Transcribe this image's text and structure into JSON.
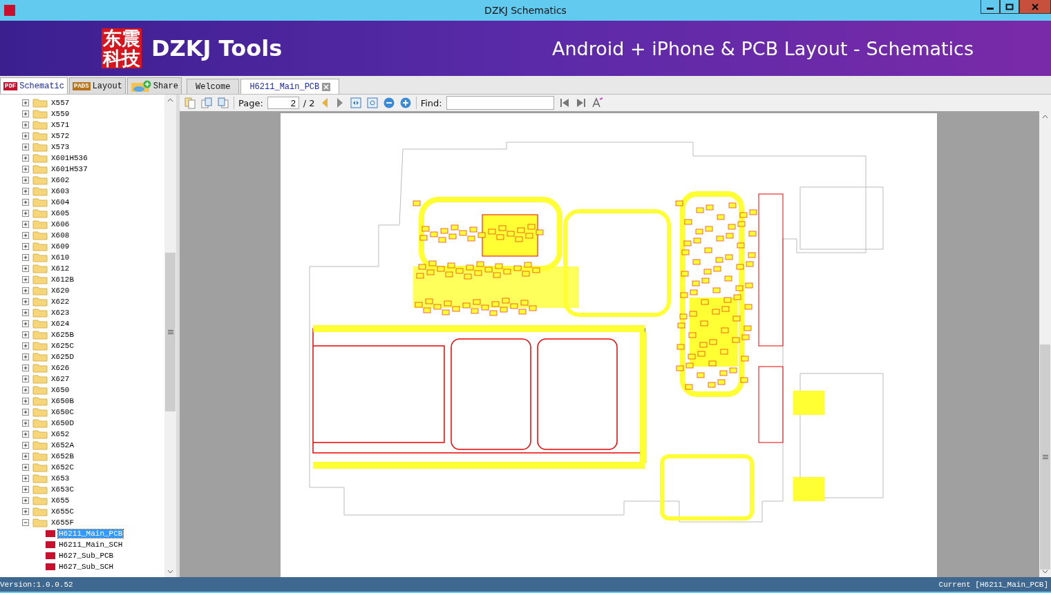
{
  "window": {
    "title": "DZKJ Schematics"
  },
  "banner": {
    "logo_text": "东震科技",
    "brand": "DZKJ Tools",
    "tagline": "Android + iPhone & PCB Layout - Schematics"
  },
  "side_tabs": [
    {
      "label": "Schematic",
      "badge": "PDF",
      "kind": "pdf",
      "selected": true
    },
    {
      "label": "Layout",
      "badge": "PADS",
      "kind": "pads",
      "selected": false
    },
    {
      "label": "Share",
      "kind": "share",
      "selected": false
    }
  ],
  "doc_tabs": [
    {
      "label": "Welcome",
      "selected": false,
      "closable": false
    },
    {
      "label": "H6211_Main_PCB",
      "selected": true,
      "closable": true
    }
  ],
  "tree": [
    {
      "label": "X557",
      "expanded": false
    },
    {
      "label": "X559",
      "expanded": false
    },
    {
      "label": "X571",
      "expanded": false
    },
    {
      "label": "X572",
      "expanded": false
    },
    {
      "label": "X573",
      "expanded": false
    },
    {
      "label": "X601H536",
      "expanded": false
    },
    {
      "label": "X601H537",
      "expanded": false
    },
    {
      "label": "X602",
      "expanded": false
    },
    {
      "label": "X603",
      "expanded": false
    },
    {
      "label": "X604",
      "expanded": false
    },
    {
      "label": "X605",
      "expanded": false
    },
    {
      "label": "X606",
      "expanded": false
    },
    {
      "label": "X608",
      "expanded": false
    },
    {
      "label": "X609",
      "expanded": false
    },
    {
      "label": "X610",
      "expanded": false
    },
    {
      "label": "X612",
      "expanded": false
    },
    {
      "label": "X612B",
      "expanded": false
    },
    {
      "label": "X620",
      "expanded": false
    },
    {
      "label": "X622",
      "expanded": false
    },
    {
      "label": "X623",
      "expanded": false
    },
    {
      "label": "X624",
      "expanded": false
    },
    {
      "label": "X625B",
      "expanded": false
    },
    {
      "label": "X625C",
      "expanded": false
    },
    {
      "label": "X625D",
      "expanded": false
    },
    {
      "label": "X626",
      "expanded": false
    },
    {
      "label": "X627",
      "expanded": false
    },
    {
      "label": "X650",
      "expanded": false
    },
    {
      "label": "X650B",
      "expanded": false
    },
    {
      "label": "X650C",
      "expanded": false
    },
    {
      "label": "X650D",
      "expanded": false
    },
    {
      "label": "X652",
      "expanded": false
    },
    {
      "label": "X652A",
      "expanded": false
    },
    {
      "label": "X652B",
      "expanded": false
    },
    {
      "label": "X652C",
      "expanded": false
    },
    {
      "label": "X653",
      "expanded": false
    },
    {
      "label": "X653C",
      "expanded": false
    },
    {
      "label": "X655",
      "expanded": false
    },
    {
      "label": "X655C",
      "expanded": false
    },
    {
      "label": "X655F",
      "expanded": true,
      "children": [
        {
          "label": "H6211_Main_PCB",
          "selected": true
        },
        {
          "label": "H6211_Main_SCH",
          "selected": false
        },
        {
          "label": "H627_Sub_PCB",
          "selected": false
        },
        {
          "label": "H627_Sub_SCH",
          "selected": false
        }
      ]
    }
  ],
  "toolbar": {
    "page_label": "Page:",
    "page_value": "2",
    "page_total": "/ 2",
    "find_label": "Find:"
  },
  "status_bar": {
    "version": "Version:1.0.0.52",
    "current": "Current [H6211_Main_PCB]"
  }
}
